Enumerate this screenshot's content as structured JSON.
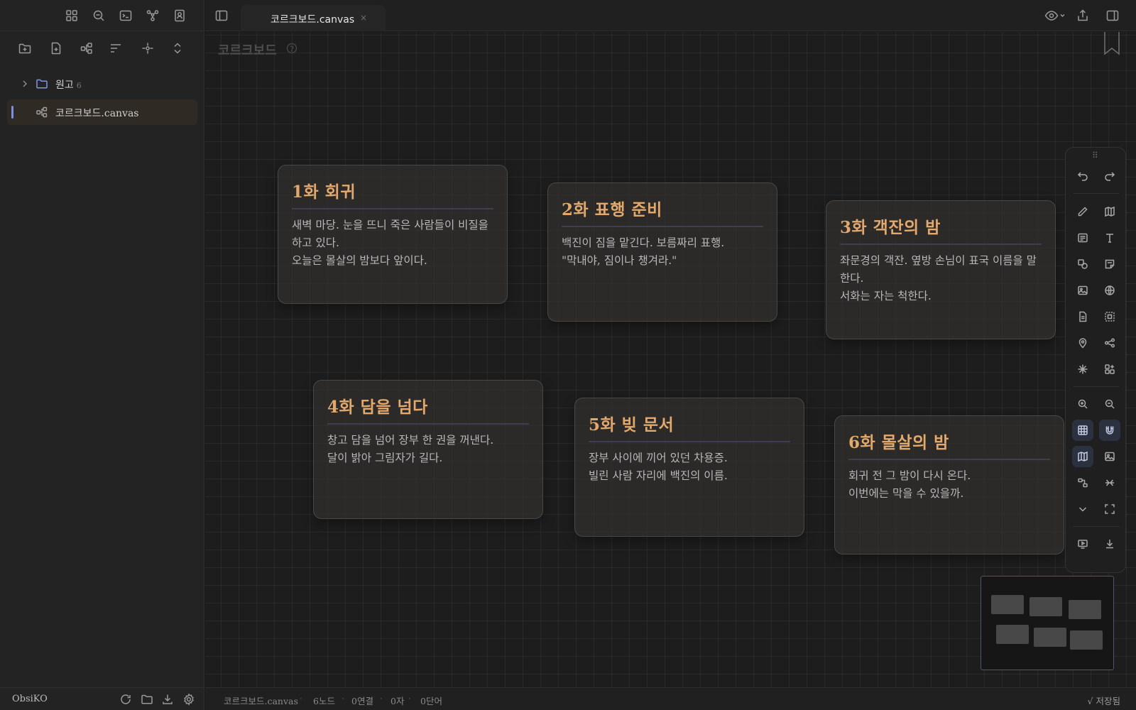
{
  "sidebar": {
    "tree": [
      {
        "label": "원고",
        "count": "6"
      },
      {
        "label": "코르크보드.canvas"
      }
    ],
    "vault_name": "ObsiKO"
  },
  "tab": {
    "title": "코르크보드.canvas",
    "close": "×"
  },
  "canvas": {
    "title": "코르크보드",
    "cards": [
      {
        "title": "1화 회귀",
        "lines": [
          "새벽 마당. 눈을 뜨니 죽은 사람들이 비질을 하고 있다.",
          "오늘은 몰살의 밤보다 앞이다."
        ]
      },
      {
        "title": "2화 표행 준비",
        "lines": [
          "백진이 짐을 맡긴다. 보름짜리 표행.",
          "\"막내야, 짐이나 챙겨라.\""
        ]
      },
      {
        "title": "3화 객잔의 밤",
        "lines": [
          "좌문경의 객잔. 옆방 손님이 표국 이름을 말한다.",
          "서화는 자는 척한다."
        ]
      },
      {
        "title": "4화 담을 넘다",
        "lines": [
          "창고 담을 넘어 장부 한 권을 꺼낸다.",
          "달이 밝아 그림자가 길다."
        ]
      },
      {
        "title": "5화 빚 문서",
        "lines": [
          "장부 사이에 끼어 있던 차용증.",
          "빌린 사람 자리에 백진의 이름."
        ]
      },
      {
        "title": "6화 몰살의 밤",
        "lines": [
          "회귀 전 그 밤이 다시 온다.",
          "이번에는 막을 수 있을까."
        ]
      }
    ]
  },
  "statusbar": {
    "file": "코르크보드.canvas",
    "nodes": "6노드",
    "links": "0연결",
    "chars": "0자",
    "words": "0단어",
    "saved": "√ 저장됨"
  }
}
